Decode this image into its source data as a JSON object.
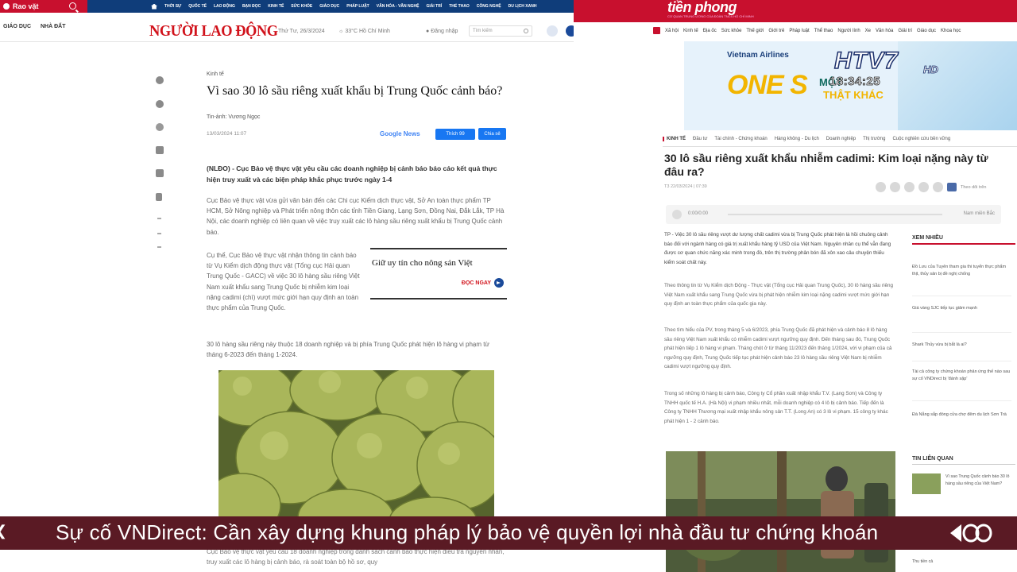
{
  "left_site": {
    "rao_vat": "Rao vặt",
    "top_nav": [
      "THỜI SỰ",
      "QUỐC TẾ",
      "LAO ĐỘNG",
      "BẠN ĐỌC",
      "KINH TẾ",
      "SỨC KHỎE",
      "GIÁO DỤC",
      "PHÁP LUẬT",
      "VĂN HÓA - VĂN NGHỆ",
      "GIẢI TRÍ",
      "THỂ THAO",
      "CÔNG NGHỆ",
      "DU LỊCH XANH"
    ],
    "cat_bar": [
      "GIÁO DỤC",
      "NHÀ ĐẤT"
    ],
    "logo": "NGƯỜI LAO ĐỘNG",
    "date": "Thứ Tư, 26/3/2024",
    "weather": "33°C Hồ Chí Minh",
    "login": "Đăng nhập",
    "search_placeholder": "Tìm kiếm",
    "article": {
      "kicker": "Kinh tế",
      "title": "Vì sao 30 lô sầu riêng xuất khẩu bị Trung Quốc cảnh báo?",
      "byline": "Tin-ảnh: Vương Ngọc",
      "datetime": "13/03/2024 11:07",
      "google_news": "Google News",
      "fb_button": "Thích 99",
      "share_button": "Chia sẻ",
      "sapo": "(NLĐO) - Cục Bảo vệ thực vật yêu cầu các doanh nghiệp bị cảnh báo báo cáo kết quả thực hiện truy xuất và các biện pháp khắc phục trước ngày 1-4",
      "para1": "Cục Bảo vệ thực vật vừa gửi văn bản đến các Chi cục Kiểm dịch thực vật, Sở An toàn thực phẩm TP HCM, Sở Nông nghiệp và Phát triển nông thôn các tỉnh Tiền Giang, Lạng Sơn, Đồng Nai, Đắk Lắk, TP Hà Nội, các doanh nghiệp có liên quan về việc truy xuất các lô hàng sầu riêng xuất khẩu bị Trung Quốc cảnh báo.",
      "para2": "Cụ thể, Cục Bảo vệ thực vật nhận thông tin cảnh báo từ Vụ Kiểm dịch động thực vật (Tổng cục Hải quan Trung Quốc - GACC) về việc 30 lô hàng sầu riêng Việt Nam xuất khẩu sang Trung Quốc bị nhiễm kim loại nặng cadimi (chì) vượt mức giới hạn quy định an toàn thực phẩm của Trung Quốc.",
      "para3": "30 lô hàng sầu riêng này thuộc 18 doanh nghiệp và bị phía Trung Quốc phát hiện lô hàng vi phạm từ tháng 6-2023 đến tháng 1-2024.",
      "related_title": "Giữ uy tín cho nông sản Việt",
      "related_read": "ĐỌC NGAY",
      "caption": "Cục Bảo vệ thực vật yêu cầu 18 doanh nghiệp trong danh sách cảnh báo thực hiện điều tra nguyên nhân, truy xuất các lô hàng bị cảnh báo, rà soát toàn bộ hồ sơ, quy"
    }
  },
  "right_site": {
    "logo": "tiền phong",
    "sub": "CƠ QUAN TRUNG ƯƠNG CỦA ĐOÀN TNCS HỒ CHÍ MINH",
    "nav": [
      "Xã hội",
      "Kinh tế",
      "Địa ốc",
      "Sức khỏe",
      "Thế giới",
      "Giới trẻ",
      "Pháp luật",
      "Thể thao",
      "Người lính",
      "Xe",
      "Văn hóa",
      "Giải trí",
      "Giáo dục",
      "Khoa học"
    ],
    "ad": {
      "airline": "Vietnam Airlines",
      "one": "ONE S",
      "line1": "MỘT",
      "line2": "THẬT KHÁC"
    },
    "channel": "HTV7",
    "channel_hd": "HD",
    "clock": "18:34:25",
    "sections": [
      "KINH TẾ",
      "Đầu tư",
      "Tài chính - Chứng khoán",
      "Hàng không - Du lịch",
      "Doanh nghiệp",
      "Thị trường",
      "Cuộc nghiên cứu bền vững"
    ],
    "title": "30 lô sầu riêng xuất khẩu nhiễm cadimi: Kim loại nặng này từ đâu ra?",
    "date": "T3 22/03/2024 | 07:39",
    "google_news": "Theo dõi trên",
    "player_time": "0:00/0:00",
    "player_voice": "Nam miền Bắc",
    "lead": "TP - Việc 30 lô sầu riêng vượt dư lượng chất cadimi vừa bị Trung Quốc phát hiện là hồi chuông cảnh báo đối với ngành hàng có giá trị xuất khẩu hàng tỷ USD của Việt Nam. Nguyên nhân cụ thể vẫn đang được cơ quan chức năng xác minh trong đó, trên thị trường phân bón đã xôn xao câu chuyện thiếu kiểm soát chất này.",
    "body1": "Theo thông tin từ Vụ Kiểm dịch Động - Thực vật (Tổng cục Hải quan Trung Quốc), 30 lô hàng sầu riêng Việt Nam xuất khẩu sang Trung Quốc vừa bị phát hiện nhiễm kim loại nặng cadimi vượt mức giới hạn quy định an toàn thực phẩm của quốc gia này.",
    "body2": "Theo tìm hiểu của PV, trong tháng 5 và 6/2023, phía Trung Quốc đã phát hiện và cảnh báo 8 lô hàng sầu riêng Việt Nam xuất khẩu có nhiễm cadimi vượt ngưỡng quy định. Đến tháng sau đó, Trung Quốc phát hiện tiếp 1 lô hàng vi phạm. Tháng chót ở từ tháng 11/2023 đến tháng 1/2024, với vi phạm của cả ngưỡng quy định, Trung Quốc tiếp tục phát hiện cảnh báo 23 lô hàng sầu riêng Việt Nam bị nhiễm cadimi vượt ngưỡng quy định.",
    "body3": "Trong số những lô hàng bị cảnh báo, Công ty Cổ phần xuất nhập khẩu T.V. (Lạng Sơn) và Công ty TNHH quốc tế H.A. (Hà Nội) vi phạm nhiều nhất, mỗi doanh nghiệp có 4 lô bị cảnh báo. Tiếp đến là Công ty TNHH Thương mại xuất nhập khẩu nông sản T.T. (Long An) có 3 lô vi phạm. 15 công ty khác phát hiện 1 - 2 cảnh báo.",
    "xem_nhieu": "XEM NHIỀU",
    "xem_items": [
      "Đồ Lưu của Tuyên tham gia thi tuyển thực phẩm thịt, thủy sản bị đề nghị chống",
      "Giá vàng SJC tiếp tục giảm mạnh",
      "Shark Thủy vừa bị bắt là ai?",
      "Tài cả công ty chứng khoán phản ứng thế nào sau sự cố VNDirect bị 'đánh sập'",
      "Đà Nẵng sắp đóng cửa chợ đêm du lịch Sơn Trà"
    ],
    "tin_lien_quan": "TIN LIÊN QUAN",
    "lien_item": "Vì sao Trung Quốc cảnh báo 30 lô hàng sầu riêng của Việt Nam?",
    "lien_item2": "Thu tiền cả"
  },
  "ticker": {
    "text": "Sự cố VNDirect: Cần xây dựng khung pháp lý bảo vệ quyền lợi nhà đầu tư chứng khoán"
  },
  "colors": {
    "nld_red": "#d1121b",
    "nld_blue": "#0f3d7a",
    "tp_red": "#c8102e",
    "ticker_bg": "#5a1a24"
  }
}
